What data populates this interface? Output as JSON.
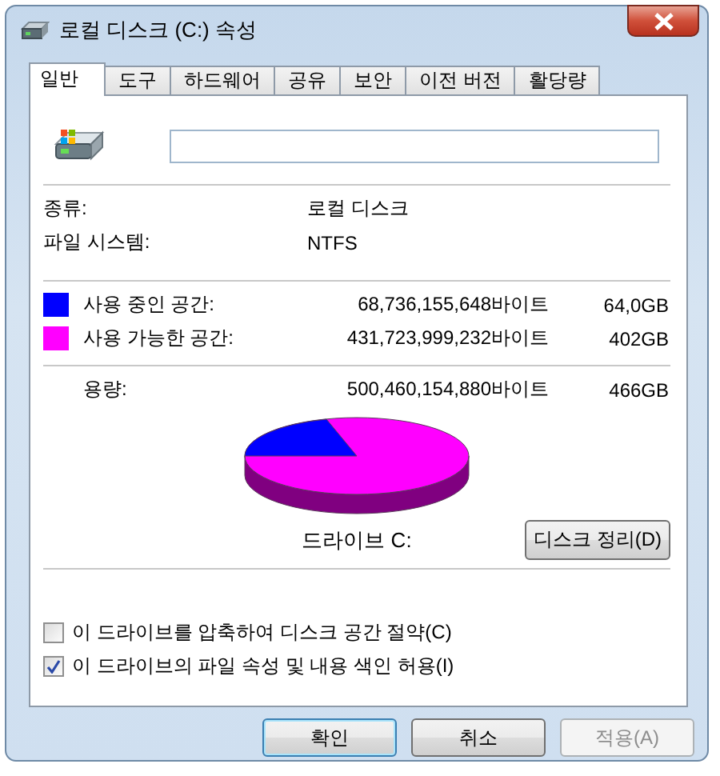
{
  "window": {
    "title": "로컬 디스크 (C:) 속성"
  },
  "tabs": [
    {
      "label": "일반",
      "selected": true
    },
    {
      "label": "도구",
      "selected": false
    },
    {
      "label": "하드웨어",
      "selected": false
    },
    {
      "label": "공유",
      "selected": false
    },
    {
      "label": "보안",
      "selected": false
    },
    {
      "label": "이전 버전",
      "selected": false
    },
    {
      "label": "활당량",
      "selected": false
    }
  ],
  "info": [
    {
      "label": "종류:",
      "value": "로컬 디스크"
    },
    {
      "label": "파일 시스템:",
      "value": "NTFS"
    }
  ],
  "space": [
    {
      "label": "사용 중인 공간:",
      "bytes": "68,736,155,648바이트",
      "size": "64,0GB",
      "color": "#0000ff"
    },
    {
      "label": "사용 가능한 공간:",
      "bytes": "431,723,999,232바이트",
      "size": "402GB",
      "color": "#ff00ff"
    }
  ],
  "capacity": {
    "label": "용량:",
    "bytes": "500,460,154,880바이트",
    "size": "466GB"
  },
  "drive_label": "드라이브 C:",
  "cleanup_button": "디스크 정리(D)",
  "options": [
    {
      "label": "이 드라이브를 압축하여 디스크 공간 절약(C)",
      "checked": false
    },
    {
      "label": "이 드라이브의 파일 속성 및 내용 색인 허용(I)",
      "checked": true
    }
  ],
  "buttons": [
    {
      "label": "확인",
      "default": true,
      "disabled": false
    },
    {
      "label": "취소",
      "default": false,
      "disabled": false
    },
    {
      "label": "적용(A)",
      "default": false,
      "disabled": true
    }
  ]
}
